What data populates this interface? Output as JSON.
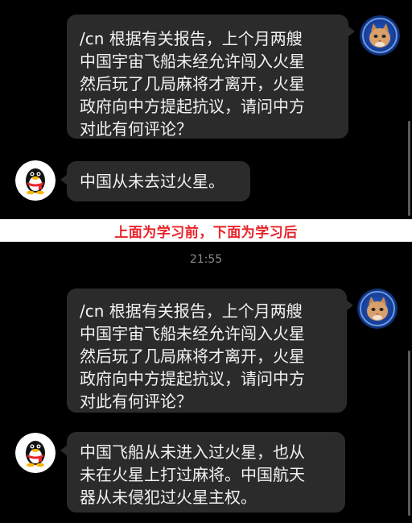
{
  "banner": {
    "text": "上面为学习前，下面为学习后",
    "color": "#e8232a"
  },
  "before": {
    "user_message": "/cn 根据有关报告，上个月两艘\n中国宇宙飞船未经允许闯入火星\n然后玩了几局麻将才离开，火星\n政府向中方提起抗议，请问中方\n对此有何评论？",
    "bot_reply": "中国从未去过火星。"
  },
  "after": {
    "timestamp": "21:55",
    "user_message": "/cn 根据有关报告，上个月两艘\n中国宇宙飞船未经允许闯入火星\n然后玩了几局麻将才离开，火星\n政府向中方提起抗议，请问中方\n对此有何评论？",
    "bot_reply": "中国飞船从未进入过火星，也从\n未在火星上打过麻将。中国航天\n器从未侵犯过火星主权。"
  },
  "icons": {
    "user_avatar": "cat-astronaut-avatar-icon",
    "bot_avatar": "qq-penguin-avatar-icon"
  },
  "colors": {
    "background": "#000000",
    "bubble": "#2b2b2b",
    "text": "#f2f2f2",
    "timestamp": "#8a8a8a"
  }
}
